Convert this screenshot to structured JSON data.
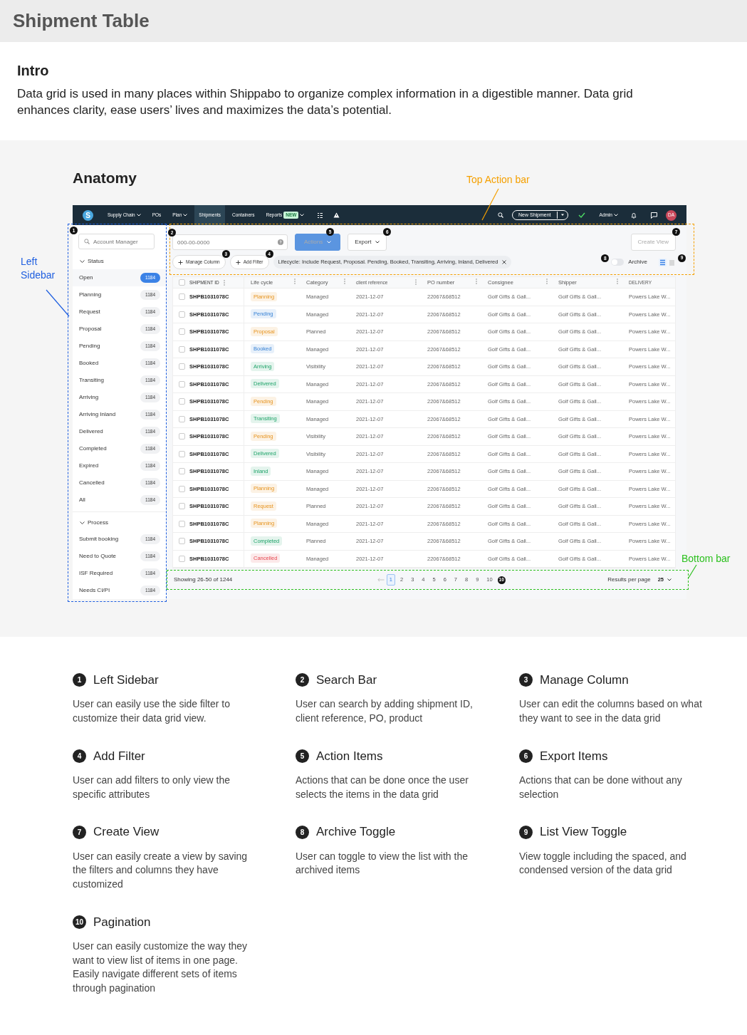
{
  "page_title": "Shipment Table",
  "intro": {
    "heading": "Intro",
    "text": "Data grid is used in many places within Shippabo to organize complex information in a digestible manner. Data grid enhances clarity, ease users’ lives and maximizes the data’s potential."
  },
  "anatomy": {
    "heading": "Anatomy",
    "callouts": [
      {
        "text": "Top Action bar",
        "color": "#f5a000"
      },
      {
        "text": "Left Sidebar",
        "color": "#1f5fe0"
      },
      {
        "text": "Bottom bar",
        "color": "#2cc01e"
      }
    ],
    "markers": [
      "1",
      "2",
      "3",
      "4",
      "5",
      "6",
      "7",
      "8",
      "9",
      "10"
    ],
    "app": {
      "nav": {
        "logo": "S",
        "items": [
          {
            "label": "Supply Chain",
            "dropdown": true,
            "selected": false
          },
          {
            "label": "POs",
            "dropdown": false,
            "selected": false
          },
          {
            "label": "Plan",
            "dropdown": true,
            "selected": false
          },
          {
            "label": "Shipments",
            "dropdown": false,
            "selected": true
          },
          {
            "label": "Containers",
            "dropdown": false,
            "selected": false
          },
          {
            "label": "Reports",
            "badge": "NEW",
            "dropdown": true,
            "selected": false
          }
        ],
        "new_shipment": "New Shipment",
        "user": "Admin",
        "avatar": "DA"
      },
      "sidebar": {
        "search_placeholder": "Account Manager",
        "groups": [
          {
            "title": "Status",
            "expanded": true,
            "items": [
              {
                "label": "Open",
                "count": "1184",
                "selected": true
              },
              {
                "label": "Planning",
                "count": "1184",
                "selected": false
              },
              {
                "label": "Request",
                "count": "1184",
                "selected": false
              },
              {
                "label": "Proposal",
                "count": "1184",
                "selected": false
              },
              {
                "label": "Pending",
                "count": "1184",
                "selected": false
              },
              {
                "label": "Booked",
                "count": "1184",
                "selected": false
              },
              {
                "label": "Transiting",
                "count": "1184",
                "selected": false
              },
              {
                "label": "Arriving",
                "count": "1184",
                "selected": false
              },
              {
                "label": "Arriving Inland",
                "count": "1184",
                "selected": false
              },
              {
                "label": "Delivered",
                "count": "1184",
                "selected": false
              },
              {
                "label": "Completed",
                "count": "1184",
                "selected": false
              },
              {
                "label": "Expired",
                "count": "1184",
                "selected": false
              },
              {
                "label": "Cancelled",
                "count": "1184",
                "selected": false
              },
              {
                "label": "All",
                "count": "1184",
                "selected": false
              }
            ]
          },
          {
            "title": "Process",
            "expanded": true,
            "items": [
              {
                "label": "Submit booking",
                "count": "1184",
                "selected": false
              },
              {
                "label": "Need to Quote",
                "count": "1184",
                "selected": false
              },
              {
                "label": "ISF Required",
                "count": "1184",
                "selected": false
              },
              {
                "label": "Needs CI/PI",
                "count": "1184",
                "selected": false
              }
            ]
          }
        ]
      },
      "toolbar": {
        "search_placeholder": "000-00-0000",
        "actions": {
          "label": "Actions",
          "disabled": true
        },
        "export": "Export",
        "create_view": {
          "label": "Create View",
          "disabled": true
        },
        "manage_column": "Manage Column",
        "add_filter": "Add Filter",
        "filter_chip": "Lifecycle: Include Request, Proposal. Pending, Booked, Transiting, Arriving, Inland, Delivered",
        "archive": {
          "label": "Archive",
          "on": false
        },
        "views": [
          {
            "kind": "spaced",
            "selected": true
          },
          {
            "kind": "condensed",
            "selected": false
          }
        ]
      },
      "table": {
        "select_all": {
          "checked": false
        },
        "columns": [
          "SHIPMENT ID",
          "Life cycle",
          "Category",
          "client reference",
          "PO number",
          "Consignee",
          "Shipper",
          "DELIVERY"
        ],
        "rows": [
          {
            "checked": false,
            "shipment_id": "SHPB1031078C",
            "lifecycle": {
              "text": "Planning",
              "color": "#fcf2e4"
            },
            "category": "Managed",
            "client_reference": "2021-12-07",
            "po_number": "22067&68512",
            "consignee": "Golf Gifts & Gall...",
            "shipper": "Golf Gifts & Gall...",
            "delivery": "Powers Lake W..."
          },
          {
            "checked": false,
            "shipment_id": "SHPB1031078C",
            "lifecycle": {
              "text": "Pending",
              "color": "#e7f0fa"
            },
            "category": "Managed",
            "client_reference": "2021-12-07",
            "po_number": "22067&68512",
            "consignee": "Golf Gifts & Gall...",
            "shipper": "Golf Gifts & Gall...",
            "delivery": "Powers Lake W..."
          },
          {
            "checked": false,
            "shipment_id": "SHPB1031078C",
            "lifecycle": {
              "text": "Proposal",
              "color": "#fcf2e4"
            },
            "category": "Planned",
            "client_reference": "2021-12-07",
            "po_number": "22067&68512",
            "consignee": "Golf Gifts & Gall...",
            "shipper": "Golf Gifts & Gall...",
            "delivery": "Powers Lake W..."
          },
          {
            "checked": false,
            "shipment_id": "SHPB1031078C",
            "lifecycle": {
              "text": "Booked",
              "color": "#e7f0fa"
            },
            "category": "Managed",
            "client_reference": "2021-12-07",
            "po_number": "22067&68512",
            "consignee": "Golf Gifts & Gall...",
            "shipper": "Golf Gifts & Gall...",
            "delivery": "Powers Lake W..."
          },
          {
            "checked": false,
            "shipment_id": "SHPB1031078C",
            "lifecycle": {
              "text": "Arriving",
              "color": "#e4f4ed"
            },
            "category": "Visibility",
            "client_reference": "2021-12-07",
            "po_number": "22067&68512",
            "consignee": "Golf Gifts & Gall...",
            "shipper": "Golf Gifts & Gall...",
            "delivery": "Powers Lake W..."
          },
          {
            "checked": false,
            "shipment_id": "SHPB1031078C",
            "lifecycle": {
              "text": "Delivered",
              "color": "#e4f4ed"
            },
            "category": "Managed",
            "client_reference": "2021-12-07",
            "po_number": "22067&68512",
            "consignee": "Golf Gifts & Gall...",
            "shipper": "Golf Gifts & Gall...",
            "delivery": "Powers Lake W..."
          },
          {
            "checked": false,
            "shipment_id": "SHPB1031078C",
            "lifecycle": {
              "text": "Pending",
              "color": "#fcf2e4"
            },
            "category": "Managed",
            "client_reference": "2021-12-07",
            "po_number": "22067&68512",
            "consignee": "Golf Gifts & Gall...",
            "shipper": "Golf Gifts & Gall...",
            "delivery": "Powers Lake W..."
          },
          {
            "checked": false,
            "shipment_id": "SHPB1031078C",
            "lifecycle": {
              "text": "Transiting",
              "color": "#e4f4ed"
            },
            "category": "Managed",
            "client_reference": "2021-12-07",
            "po_number": "22067&68512",
            "consignee": "Golf Gifts & Gall...",
            "shipper": "Golf Gifts & Gall...",
            "delivery": "Powers Lake W..."
          },
          {
            "checked": false,
            "shipment_id": "SHPB1031078C",
            "lifecycle": {
              "text": "Pending",
              "color": "#fcf2e4"
            },
            "category": "Visibility",
            "client_reference": "2021-12-07",
            "po_number": "22067&68512",
            "consignee": "Golf Gifts & Gall...",
            "shipper": "Golf Gifts & Gall...",
            "delivery": "Powers Lake W..."
          },
          {
            "checked": false,
            "shipment_id": "SHPB1031078C",
            "lifecycle": {
              "text": "Delivered",
              "color": "#e4f4ed"
            },
            "category": "Visibility",
            "client_reference": "2021-12-07",
            "po_number": "22067&68512",
            "consignee": "Golf Gifts & Gall...",
            "shipper": "Golf Gifts & Gall...",
            "delivery": "Powers Lake W..."
          },
          {
            "checked": false,
            "shipment_id": "SHPB1031078C",
            "lifecycle": {
              "text": "Inland",
              "color": "#e4f4ed"
            },
            "category": "Managed",
            "client_reference": "2021-12-07",
            "po_number": "22067&68512",
            "consignee": "Golf Gifts & Gall...",
            "shipper": "Golf Gifts & Gall...",
            "delivery": "Powers Lake W..."
          },
          {
            "checked": false,
            "shipment_id": "SHPB1031078C",
            "lifecycle": {
              "text": "Planning",
              "color": "#fcf2e4"
            },
            "category": "Managed",
            "client_reference": "2021-12-07",
            "po_number": "22067&68512",
            "consignee": "Golf Gifts & Gall...",
            "shipper": "Golf Gifts & Gall...",
            "delivery": "Powers Lake W..."
          },
          {
            "checked": false,
            "shipment_id": "SHPB1031078C",
            "lifecycle": {
              "text": "Request",
              "color": "#fcf2e4"
            },
            "category": "Planned",
            "client_reference": "2021-12-07",
            "po_number": "22067&68512",
            "consignee": "Golf Gifts & Gall...",
            "shipper": "Golf Gifts & Gall...",
            "delivery": "Powers Lake W..."
          },
          {
            "checked": false,
            "shipment_id": "SHPB1031078C",
            "lifecycle": {
              "text": "Planning",
              "color": "#fcf2e4"
            },
            "category": "Managed",
            "client_reference": "2021-12-07",
            "po_number": "22067&68512",
            "consignee": "Golf Gifts & Gall...",
            "shipper": "Golf Gifts & Gall...",
            "delivery": "Powers Lake W..."
          },
          {
            "checked": false,
            "shipment_id": "SHPB1031078C",
            "lifecycle": {
              "text": "Completed",
              "color": "#e4f4ed"
            },
            "category": "Planned",
            "client_reference": "2021-12-07",
            "po_number": "22067&68512",
            "consignee": "Golf Gifts & Gall...",
            "shipper": "Golf Gifts & Gall...",
            "delivery": "Powers Lake W..."
          },
          {
            "checked": false,
            "shipment_id": "SHPB1031078C",
            "lifecycle": {
              "text": "Cancelled",
              "color": "#fce9ea"
            },
            "category": "Managed",
            "client_reference": "2021-12-07",
            "po_number": "22067&68512",
            "consignee": "Golf Gifts & Gall...",
            "shipper": "Golf Gifts & Gall...",
            "delivery": "Powers Lake W..."
          }
        ]
      },
      "footer": {
        "showing": "Showing 26-50 of 1244",
        "pages": [
          {
            "label": "1",
            "selected": true
          },
          {
            "label": "2",
            "selected": false
          },
          {
            "label": "3",
            "selected": false
          },
          {
            "label": "4",
            "selected": false
          },
          {
            "label": "5",
            "selected": false
          },
          {
            "label": "6",
            "selected": false
          },
          {
            "label": "7",
            "selected": false
          },
          {
            "label": "8",
            "selected": false
          },
          {
            "label": "9",
            "selected": false
          },
          {
            "label": "10",
            "selected": false
          }
        ],
        "results_label": "Results per page",
        "per_page": "25"
      }
    }
  },
  "notes": [
    {
      "number": "1",
      "title": "Left Sidebar",
      "text": "User can easily use the side filter to customize their data grid view."
    },
    {
      "number": "2",
      "title": "Search Bar",
      "text": "User can search by adding shipment ID, client reference, PO, product"
    },
    {
      "number": "3",
      "title": "Manage Column",
      "text": "User can edit the columns based on what they want to see in the data grid"
    },
    {
      "number": "4",
      "title": "Add Filter",
      "text": "User can add filters to only view the specific attributes"
    },
    {
      "number": "5",
      "title": "Action Items",
      "text": "Actions that can be done once the user selects the items in the data grid"
    },
    {
      "number": "6",
      "title": "Export Items",
      "text": "Actions that can be done without any selection"
    },
    {
      "number": "7",
      "title": "Create View",
      "text": "User can easily create a view by saving the filters and columns they have customized"
    },
    {
      "number": "8",
      "title": "Archive Toggle",
      "text": "User can toggle to view the list with the archived items"
    },
    {
      "number": "9",
      "title": "List View Toggle",
      "text": "View toggle including the spaced, and condensed version of the data grid"
    },
    {
      "number": "10",
      "title": "Pagination",
      "text": "User can easily customize the way they want to view list of items in one page. Easily navigate different sets of items through pagination"
    }
  ]
}
